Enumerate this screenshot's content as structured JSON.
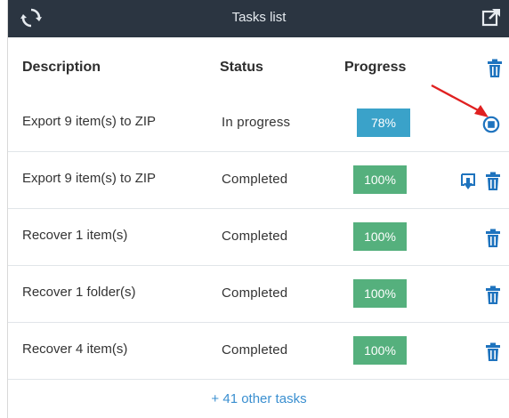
{
  "window": {
    "title": "Tasks list"
  },
  "table": {
    "columns": {
      "description": "Description",
      "status": "Status",
      "progress": "Progress"
    },
    "rows": [
      {
        "description": "Export 9 item(s) to ZIP",
        "status": "In progress",
        "progress": "78%",
        "progress_value": 78,
        "actions": [
          "stop-icon"
        ]
      },
      {
        "description": "Export 9 item(s) to ZIP",
        "status": "Completed",
        "progress": "100%",
        "progress_value": 100,
        "actions": [
          "download-icon",
          "trash-icon"
        ]
      },
      {
        "description": "Recover 1 item(s)",
        "status": "Completed",
        "progress": "100%",
        "progress_value": 100,
        "actions": [
          "trash-icon"
        ]
      },
      {
        "description": "Recover 1 folder(s)",
        "status": "Completed",
        "progress": "100%",
        "progress_value": 100,
        "actions": [
          "trash-icon"
        ]
      },
      {
        "description": "Recover 4 item(s)",
        "status": "Completed",
        "progress": "100%",
        "progress_value": 100,
        "actions": [
          "trash-icon"
        ]
      }
    ]
  },
  "footer": {
    "more_tasks": "+ 41 other tasks"
  },
  "colors": {
    "titlebar": "#2b3541",
    "in_progress_badge": "#3aa2c9",
    "completed_badge": "#55b07d",
    "icon_blue": "#1e73be",
    "link": "#3a8fd0",
    "annotation_arrow": "#e02020"
  }
}
